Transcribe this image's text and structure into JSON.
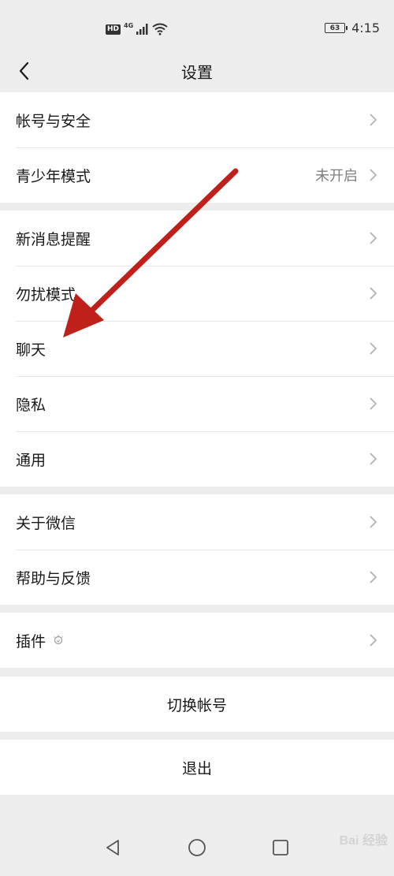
{
  "status_bar": {
    "hd": "HD",
    "network": "4G",
    "battery": "63",
    "time": "4:15"
  },
  "navbar": {
    "title": "设置",
    "back_icon": "chevron-left-icon"
  },
  "groups": [
    {
      "items": [
        {
          "label": "帐号与安全",
          "value": ""
        },
        {
          "label": "青少年模式",
          "value": "未开启"
        }
      ]
    },
    {
      "items": [
        {
          "label": "新消息提醒",
          "value": ""
        },
        {
          "label": "勿扰模式",
          "value": ""
        },
        {
          "label": "聊天",
          "value": ""
        },
        {
          "label": "隐私",
          "value": ""
        },
        {
          "label": "通用",
          "value": ""
        }
      ]
    },
    {
      "items": [
        {
          "label": "关于微信",
          "value": ""
        },
        {
          "label": "帮助与反馈",
          "value": ""
        }
      ]
    },
    {
      "items": [
        {
          "label": "插件",
          "value": ""
        }
      ]
    }
  ],
  "actions": {
    "switch_account": "切换帐号",
    "logout": "退出"
  },
  "annotation": {
    "arrow_color": "#c0201a"
  },
  "watermark": "Bai 经验",
  "colors": {
    "background": "#ededed",
    "cell": "#ffffff",
    "text": "#191919",
    "secondary": "#808080",
    "chevron": "#b2b2b2"
  }
}
